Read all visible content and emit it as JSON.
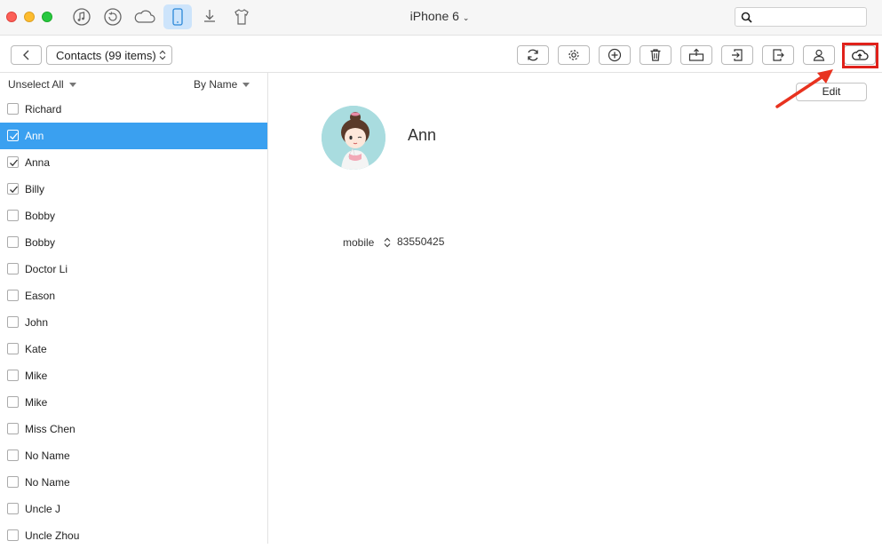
{
  "titlebar": {
    "device_name": "iPhone 6",
    "icons": [
      "music-icon",
      "restore-icon",
      "cloud-icon",
      "phone-icon",
      "download-icon",
      "tshirt-icon"
    ],
    "search": {
      "value": "",
      "placeholder": ""
    }
  },
  "toolbar": {
    "category": "Contacts (99 items)",
    "buttons": [
      "refresh-icon",
      "settings-icon",
      "add-icon",
      "delete-icon",
      "import-to-computer-icon",
      "to-device-icon",
      "to-itunes-icon",
      "contact-icon",
      "upload-cloud-icon"
    ]
  },
  "list": {
    "unselect_label": "Unselect All",
    "sort_label": "By Name",
    "contacts": [
      {
        "name": "Richard",
        "checked": false,
        "selected": false
      },
      {
        "name": "Ann",
        "checked": true,
        "selected": true
      },
      {
        "name": "Anna",
        "checked": true,
        "selected": false
      },
      {
        "name": "Billy",
        "checked": true,
        "selected": false
      },
      {
        "name": "Bobby",
        "checked": false,
        "selected": false
      },
      {
        "name": "Bobby",
        "checked": false,
        "selected": false
      },
      {
        "name": "Doctor Li",
        "checked": false,
        "selected": false
      },
      {
        "name": "Eason",
        "checked": false,
        "selected": false
      },
      {
        "name": "John",
        "checked": false,
        "selected": false
      },
      {
        "name": "Kate",
        "checked": false,
        "selected": false
      },
      {
        "name": "Mike",
        "checked": false,
        "selected": false
      },
      {
        "name": "Mike",
        "checked": false,
        "selected": false
      },
      {
        "name": "Miss Chen",
        "checked": false,
        "selected": false
      },
      {
        "name": "No Name",
        "checked": false,
        "selected": false
      },
      {
        "name": "No Name",
        "checked": false,
        "selected": false
      },
      {
        "name": "Uncle J",
        "checked": false,
        "selected": false
      },
      {
        "name": "Uncle Zhou",
        "checked": false,
        "selected": false
      }
    ]
  },
  "detail": {
    "edit_label": "Edit",
    "name": "Ann",
    "field_label": "mobile",
    "field_value": "83550425"
  },
  "colors": {
    "selection": "#3aa0f0",
    "highlight": "#e0211b",
    "active_tab": "#cde4fb"
  }
}
